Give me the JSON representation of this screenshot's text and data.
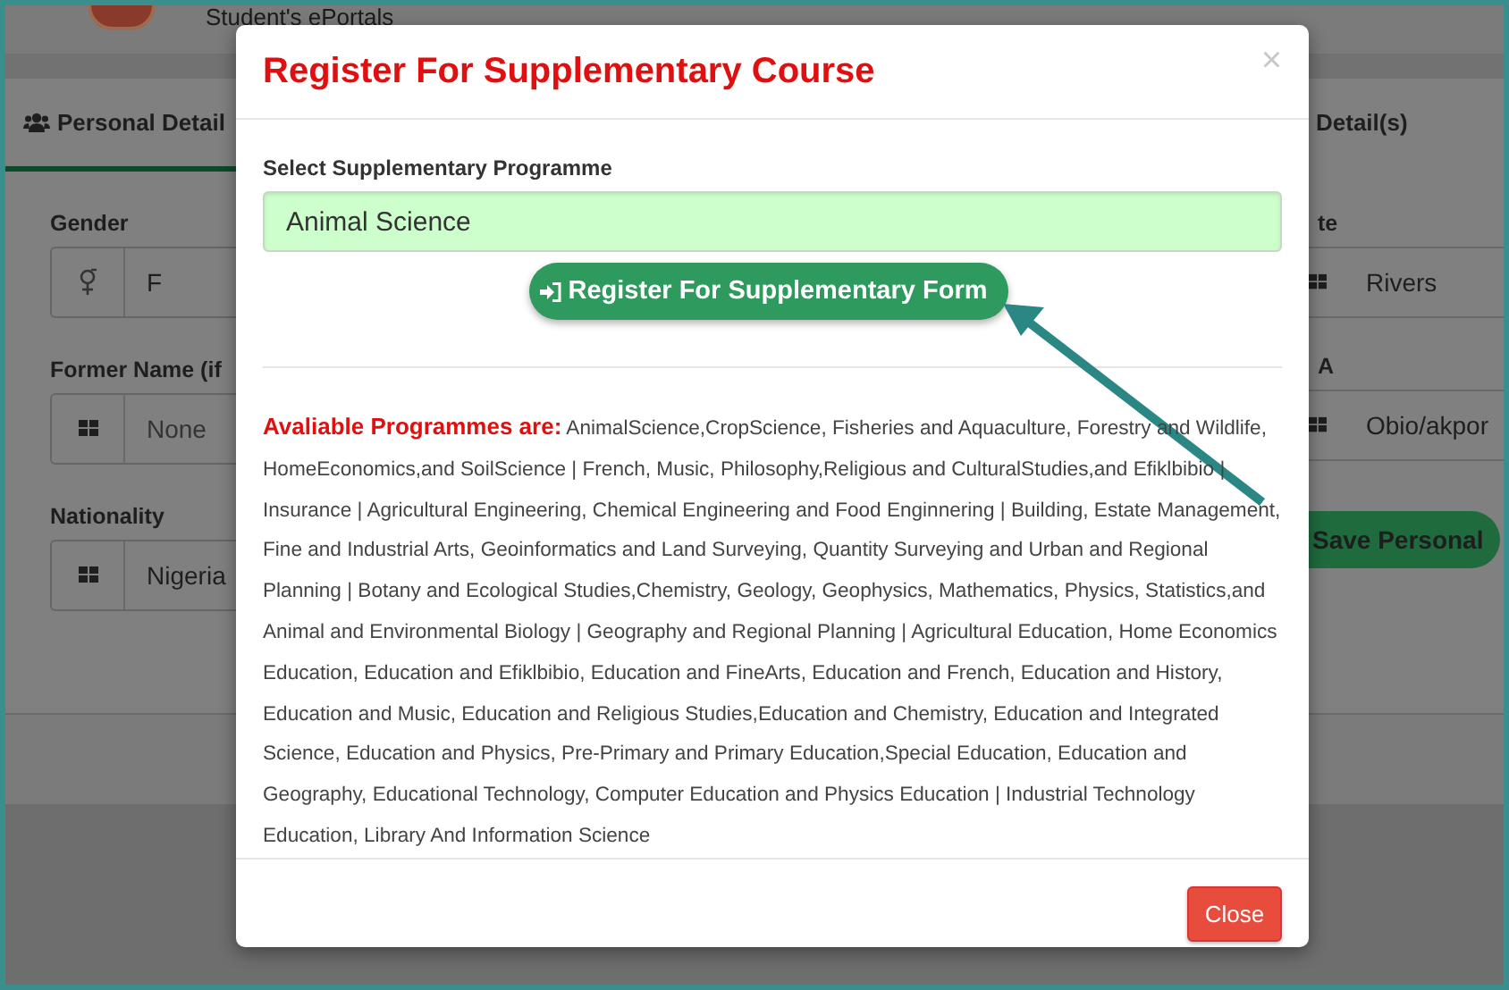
{
  "page": {
    "header_title": "Student's ePortals",
    "tabs": [
      {
        "label": "Personal Detail",
        "selected": true
      },
      {
        "label": "Detail(s)",
        "selected": false
      }
    ],
    "left_fields": [
      {
        "label": "Gender",
        "value": "F"
      },
      {
        "label": "Former Name (if",
        "value": "None"
      },
      {
        "label": "Nationality",
        "value": "Nigeria"
      }
    ],
    "right_fields": [
      {
        "label": "te",
        "value": "Rivers"
      },
      {
        "label": "A",
        "value": "Obio/akpor"
      }
    ],
    "save_button": "Save Personal"
  },
  "modal": {
    "title": "Register For Supplementary Course",
    "close_glyph": "×",
    "field_label": "Select Supplementary Programme",
    "field_value": "Animal Science",
    "register_button": "Register For Supplementary Form",
    "programmes_label": "Avaliable Programmes are:",
    "programmes": "AnimalScience,CropScience, Fisheries and Aquaculture, Forestry and Wildlife, HomeEconomics,and SoilScience | French, Music, Philosophy,Religious and CulturalStudies,and Efiklbibio | Insurance | Agricultural Engineering, Chemical Engineering and Food Enginnering | Building, Estate Management, Fine and Industrial Arts, Geoinformatics and Land Surveying, Quantity Surveying and Urban and Regional Planning | Botany and Ecological Studies,Chemistry, Geology, Geophysics, Mathematics, Physics, Statistics,and Animal and Environmental Biology | Geography and Regional Planning | Agricultural Education, Home Economics Education, Education and Efiklbibio, Education and FineArts, Education and French, Education and History, Education and Music, Education and Religious Studies,Education and Chemistry, Education and Integrated Science, Education and Physics, Pre-Primary and Primary Education,Special Education, Education and Geography, Educational Technology, Computer Education and Physics Education | Industrial Technology Education, Library And Information Science",
    "close_button": "Close"
  }
}
